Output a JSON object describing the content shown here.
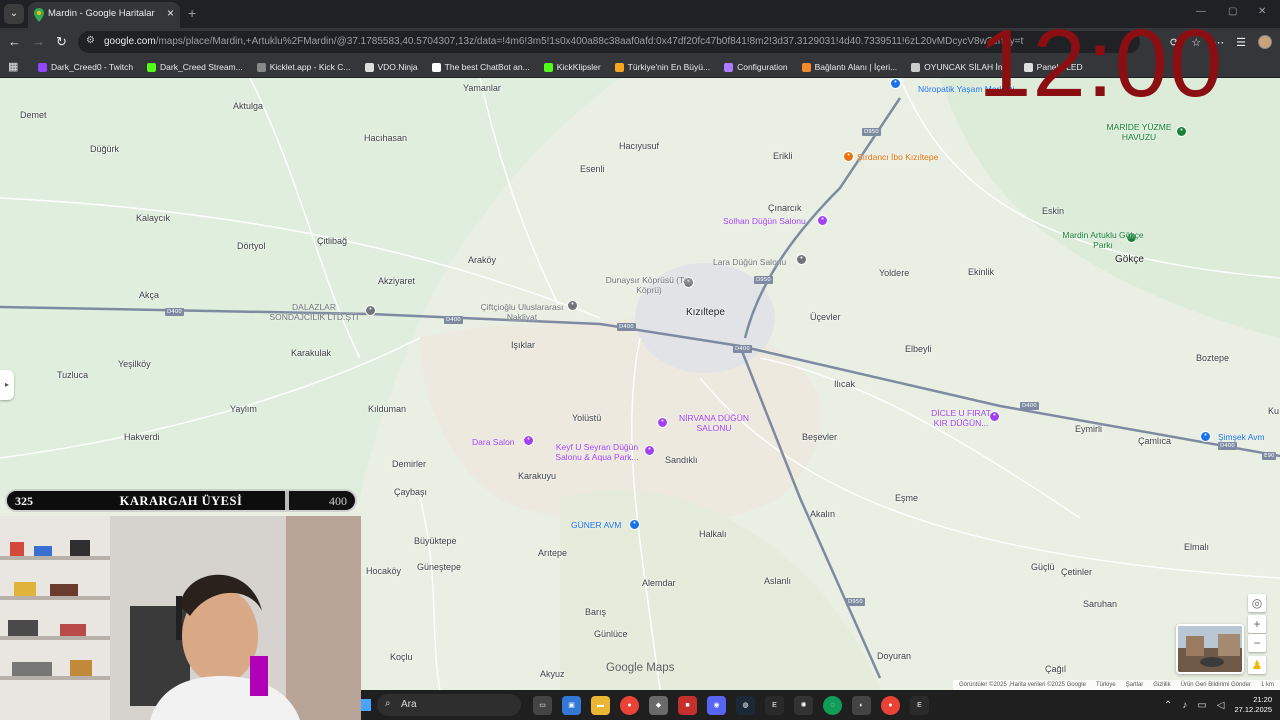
{
  "browser": {
    "tab_title": "Mardin - Google Haritalar",
    "url_host": "google.com",
    "url_path": "/maps/place/Mardin,+Artuklu%2FMardin/@37.1785583,40.5704307,13z/data=!4m6!3m5!1s0x400a88c38aaf0afd:0x47df20fc47b0f841!8m2!3d37.3129031!4d40.7339511!6zL20vMDcycV8w?entry=ttu&g_ep=EgoyMDI1MTIxOS4wI...",
    "bookmarks": [
      {
        "label": "Dark_Creed0 - Twitch",
        "color": "#9146ff"
      },
      {
        "label": "Dark_Creed Stream...",
        "color": "#53fc18"
      },
      {
        "label": "Kicklet.app - Kick C...",
        "color": "#888888"
      },
      {
        "label": "VDO.Ninja",
        "color": "#dddddd"
      },
      {
        "label": "The best ChatBot an...",
        "color": "#ffffff"
      },
      {
        "label": "KickKlipsler",
        "color": "#53fc18"
      },
      {
        "label": "Türkiye'nin En Büyü...",
        "color": "#f5a623"
      },
      {
        "label": "Configuration",
        "color": "#b07cff"
      },
      {
        "label": "Bağlantı Alanı | İçeri...",
        "color": "#f28b30"
      },
      {
        "label": "OYUNCAK SİLAH İn...",
        "color": "#cccccc"
      },
      {
        "label": "Panel • LED",
        "color": "#dddddd"
      }
    ]
  },
  "map": {
    "places": [
      {
        "name": "Demet"
      },
      {
        "name": "Aktulga"
      },
      {
        "name": "Yamanlar"
      },
      {
        "name": "Hacıhasan"
      },
      {
        "name": "Hacıyusuf"
      },
      {
        "name": "Düğürk"
      },
      {
        "name": "Esenli"
      },
      {
        "name": "Erikli"
      },
      {
        "name": "Kalaycık"
      },
      {
        "name": "Çınarcık"
      },
      {
        "name": "Eskin"
      },
      {
        "name": "Dörtyol"
      },
      {
        "name": "Çitlibağ"
      },
      {
        "name": "Araköy"
      },
      {
        "name": "Yoldere"
      },
      {
        "name": "Ekinlik"
      },
      {
        "name": "Gökçe"
      },
      {
        "name": "Akziyaret"
      },
      {
        "name": "Akça"
      },
      {
        "name": "Kızıltepe"
      },
      {
        "name": "Üçevler"
      },
      {
        "name": "Işıklar"
      },
      {
        "name": "Elbeyli"
      },
      {
        "name": "Boztepe"
      },
      {
        "name": "Karakulak"
      },
      {
        "name": "Tuzluca"
      },
      {
        "name": "Yeşilköy"
      },
      {
        "name": "Ilıcak"
      },
      {
        "name": "Yaylım"
      },
      {
        "name": "Kılduman"
      },
      {
        "name": "Yolüstü"
      },
      {
        "name": "Eymirli"
      },
      {
        "name": "Çamlıca"
      },
      {
        "name": "Hakverdi"
      },
      {
        "name": "Beşevler"
      },
      {
        "name": "Sandıklı"
      },
      {
        "name": "Demirler"
      },
      {
        "name": "Karakuyu"
      },
      {
        "name": "Çaybaşı"
      },
      {
        "name": "Eşme"
      },
      {
        "name": "Akalın"
      },
      {
        "name": "Büyüktepe"
      },
      {
        "name": "Arıtepe"
      },
      {
        "name": "Halkalı"
      },
      {
        "name": "Elmalı"
      },
      {
        "name": "Hocaköy"
      },
      {
        "name": "Güneştepe"
      },
      {
        "name": "Alemdar"
      },
      {
        "name": "Aslanlı"
      },
      {
        "name": "Güçlü"
      },
      {
        "name": "Çetinler"
      },
      {
        "name": "Barış"
      },
      {
        "name": "Saruhan"
      },
      {
        "name": "Günlüce"
      },
      {
        "name": "Koçlu"
      },
      {
        "name": "Doyuran"
      },
      {
        "name": "Akyuz"
      },
      {
        "name": "Çağıl"
      },
      {
        "name": "Ku"
      }
    ],
    "pois": [
      {
        "name": "Şırdancı İbo Kızıltepe",
        "color": "#e8710a"
      },
      {
        "name": "Solhan Düğün Salonu",
        "color": "#a142f4"
      },
      {
        "name": "Lara Düğün Salonu",
        "color": "#70757a"
      },
      {
        "name": "Dunaysır Köprüsü (Taş Köprü)",
        "color": "#70757a"
      },
      {
        "name": "Çiftçioğlu Uluslararası Nakliyat",
        "color": "#70757a"
      },
      {
        "name": "DALAZLAR SONDAJCILIK LTD.ŞTİ",
        "color": "#70757a"
      },
      {
        "name": "NİRVANA DÜĞÜN SALONU",
        "color": "#a142f4"
      },
      {
        "name": "Dara Salon",
        "color": "#a142f4"
      },
      {
        "name": "Keyf U Seyran Düğün Salonu & Aqua Park...",
        "color": "#a142f4"
      },
      {
        "name": "GÜNER AVM",
        "color": "#1a73e8"
      },
      {
        "name": "DİCLE U FIRAT KIR DÜĞÜN...",
        "color": "#a142f4"
      },
      {
        "name": "Şimşek Avm",
        "color": "#1a73e8"
      },
      {
        "name": "Mardin Artuklu Gökçe Parkı",
        "color": "#188038"
      },
      {
        "name": "MARİDE YÜZME HAVUZU",
        "color": "#188038"
      },
      {
        "name": "Nöropatik Yaşam Merkezi",
        "color": "#1a73e8"
      }
    ],
    "roads": [
      "D400",
      "D950",
      "E90"
    ],
    "logo": "Google Maps",
    "attribution": [
      "Görüntüler ©2025 ,Harita verileri ©2025 Google",
      "Türkiye",
      "Şartlar",
      "Gizlilik",
      "Ürün Geri Bildirimi Gönder",
      "1 km"
    ]
  },
  "overlay": {
    "clock": "12:00",
    "xp": {
      "current": "325",
      "title": "KARARGAH ÜYESİ",
      "max": "400",
      "progress_fraction": 0.81
    }
  },
  "taskbar": {
    "search_placeholder": "Ara",
    "time": "21:20",
    "date": "27.12.2025"
  }
}
